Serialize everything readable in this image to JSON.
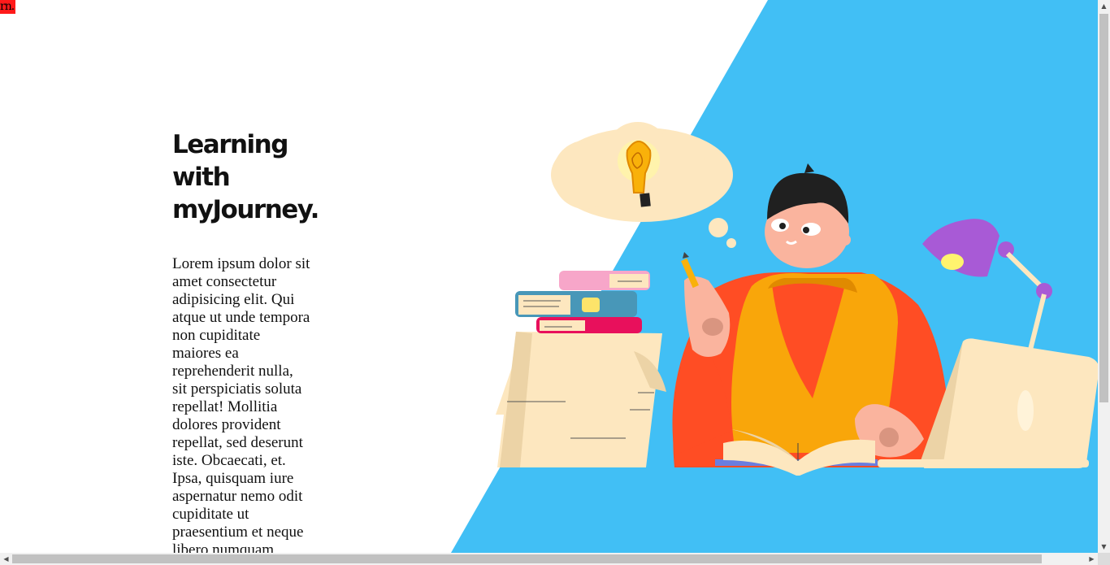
{
  "logo": {
    "text": "rn."
  },
  "colors": {
    "accent_blue": "#41bff5",
    "tag_red": "#ff1a1a",
    "sweater": "#ff4d24",
    "vest": "#f9a60a",
    "lamp": "#a85ad6",
    "paper": "#fde7bf"
  },
  "hero": {
    "title_line1": "Learning",
    "title_line2": "with",
    "title_line3": "myJourney.",
    "description": "Lorem ipsum dolor sit amet consectetur adipisicing elit. Qui atque ut unde tempora non cupiditate maiores ea reprehenderit nulla, sit perspiciatis soluta repellat! Mollitia dolores provident repellat, sed deserunt iste. Obcaecati, et. Ipsa, quisquam iure aspernatur nemo odit cupiditate ut praesentium et neque libero numquam"
  },
  "illustration": {
    "icons": [
      "lightbulb-icon",
      "thought-bubble",
      "book-stack",
      "paper-stack",
      "student",
      "desk-lamp",
      "laptop",
      "open-book",
      "pencil"
    ]
  },
  "scrollbars": {
    "up": "▲",
    "down": "▼",
    "left": "◀",
    "right": "▶"
  }
}
